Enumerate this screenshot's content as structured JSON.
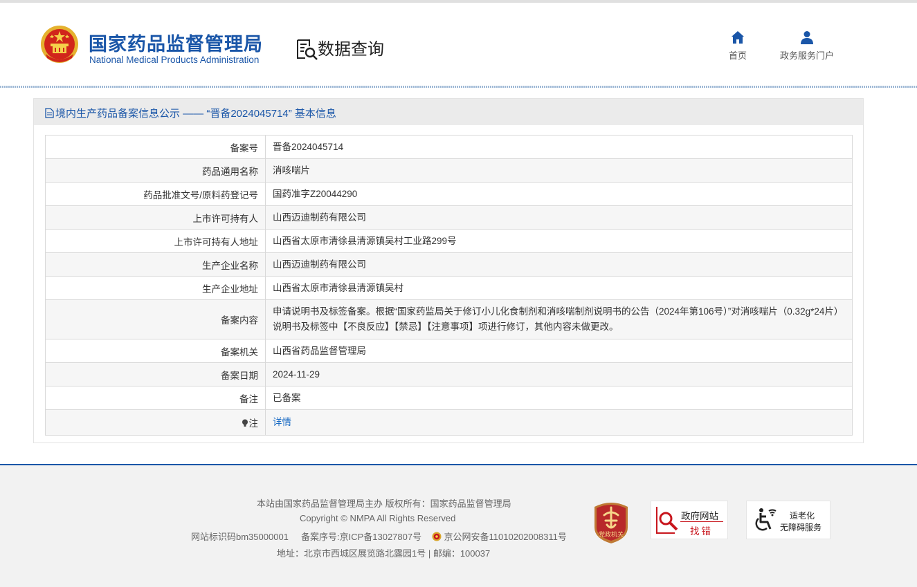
{
  "header": {
    "brand_cn": "国家药品监督管理局",
    "brand_en": "National Medical Products Administration",
    "section_title": "数据查询",
    "nav": [
      {
        "label": "首页",
        "icon": "home-icon"
      },
      {
        "label": "政务服务门户",
        "icon": "user-icon"
      }
    ]
  },
  "panel": {
    "title": "境内生产药品备案信息公示 —— “晋备2024045714” 基本信息"
  },
  "rows": [
    {
      "key": "备案号",
      "value": "晋备2024045714"
    },
    {
      "key": "药品通用名称",
      "value": "消咳喘片"
    },
    {
      "key": "药品批准文号/原料药登记号",
      "value": "国药准字Z20044290"
    },
    {
      "key": "上市许可持有人",
      "value": "山西迈迪制药有限公司"
    },
    {
      "key": "上市许可持有人地址",
      "value": "山西省太原市清徐县清源镇吴村工业路299号"
    },
    {
      "key": "生产企业名称",
      "value": "山西迈迪制药有限公司"
    },
    {
      "key": "生产企业地址",
      "value": "山西省太原市清徐县清源镇吴村"
    },
    {
      "key": "备案内容",
      "value": "申请说明书及标签备案。根据“国家药监局关于修订小儿化食制剂和消咳喘制剂说明书的公告（2024年第106号）”对消咳喘片（0.32g*24片）说明书及标签中【不良反应】【禁忌】【注意事项】项进行修订，其他内容未做更改。"
    },
    {
      "key": "备案机关",
      "value": "山西省药品监督管理局"
    },
    {
      "key": "备案日期",
      "value": "2024-11-29"
    },
    {
      "key": "备注",
      "value": "已备案"
    },
    {
      "key": "注",
      "value": "详情"
    }
  ],
  "footer": {
    "line1": "本站由国家药品监督管理局主办 版权所有：国家药品监督管理局",
    "line2": "Copyright © NMPA All Rights Reserved",
    "site_id": "网站标识码bm35000001",
    "icp": "备案序号:京ICP备13027807号",
    "police": "京公网安备11010202008311号",
    "address": "地址：北京市西城区展览路北露园1号 | 邮编：100037",
    "badge_party": "党政机关",
    "badge_error_line1": "政府网站",
    "badge_error_line2": "找错",
    "badge_access_line1": "适老化",
    "badge_access_line2": "无障碍服务"
  },
  "colors": {
    "brand_blue": "#1a56a8",
    "link_blue": "#1a6bc4",
    "error_red": "#c8161d"
  }
}
